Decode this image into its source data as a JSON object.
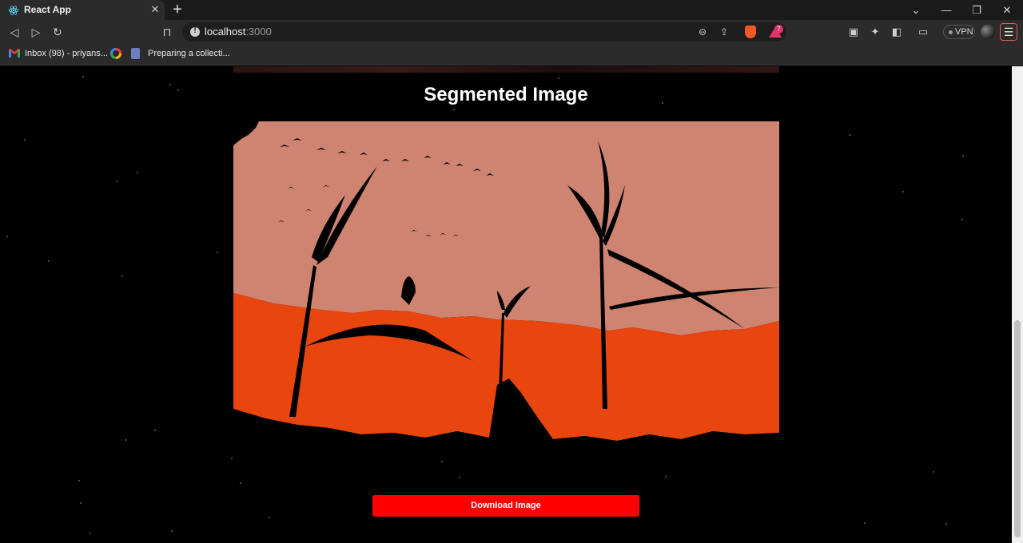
{
  "browser": {
    "tab": {
      "title": "React App",
      "favicon": "react-icon"
    },
    "address": {
      "host": "localhost",
      "port": ":3000"
    },
    "vpn_label": "VPN",
    "rewards_count": "7",
    "bookmarks": [
      {
        "label": "Inbox (98) - priyans...",
        "icon": "gmail-icon"
      },
      {
        "label": "",
        "icon": "google-icon"
      },
      {
        "label": "Preparing a collecti...",
        "icon": "doc-icon"
      }
    ]
  },
  "page": {
    "heading": "Segmented Image",
    "download_label": "Download Image",
    "colors": {
      "background": "#000000",
      "sky": "#cf8472",
      "field": "#e8450f",
      "button": "#ff0000"
    }
  }
}
